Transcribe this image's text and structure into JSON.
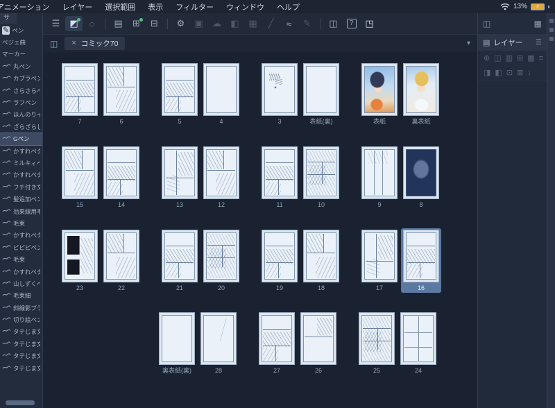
{
  "menubar": {
    "items": [
      "アニメーション",
      "レイヤー",
      "選択範囲",
      "表示",
      "フィルター",
      "ウィンドウ",
      "ヘルプ"
    ],
    "status": {
      "battery": "13%",
      "wifi_icon": "wifi-icon",
      "battery_icon": "battery-charging-icon",
      "bolt": "⚡"
    }
  },
  "toolbar": {
    "tools": [
      {
        "name": "main-menu-icon",
        "glyph": "☰"
      },
      {
        "name": "selection-tool-icon",
        "glyph": "◩",
        "active": true,
        "badge": true
      },
      {
        "name": "deselect-icon",
        "glyph": "◌"
      },
      {
        "sep": true
      },
      {
        "name": "page-manager-icon",
        "glyph": "▤"
      },
      {
        "name": "add-page-icon",
        "glyph": "⊞",
        "badge": true
      },
      {
        "name": "delete-page-icon",
        "glyph": "⊟"
      },
      {
        "sep": true
      },
      {
        "name": "settings-gear-icon",
        "glyph": "⚙"
      },
      {
        "name": "layers-stack-icon",
        "glyph": "▣",
        "disabled": true
      },
      {
        "name": "cloud-sync-icon",
        "glyph": "☁",
        "disabled": true
      },
      {
        "name": "fill-tool-icon",
        "glyph": "◧",
        "disabled": true
      },
      {
        "name": "grid-view-icon",
        "glyph": "▦",
        "disabled": true
      },
      {
        "name": "line-tool-icon",
        "glyph": "╱",
        "disabled": true
      },
      {
        "name": "curve-tool-icon",
        "glyph": "≈"
      },
      {
        "name": "pencil-tool-icon",
        "glyph": "✎",
        "disabled": true
      },
      {
        "sep": true
      },
      {
        "name": "reference-panel-icon",
        "glyph": "◫"
      },
      {
        "name": "help-icon",
        "glyph": "?",
        "boxed": true
      },
      {
        "name": "export-canvas-icon",
        "glyph": "◳",
        "bright": true
      }
    ]
  },
  "tabbar": {
    "title": "コミック70",
    "close": "×",
    "chevron": "▾",
    "pages_view_glyph": "◫"
  },
  "sidebar": {
    "panel_tab": "サ",
    "items": [
      {
        "label": "ペン",
        "pen_icon": true
      },
      {
        "label": "ベジェ曲"
      },
      {
        "label": "マーカー"
      },
      {
        "label": "丸ペン",
        "stroke": true
      },
      {
        "label": "カブラペン",
        "stroke": true
      },
      {
        "label": "さらさらペ",
        "stroke": true
      },
      {
        "label": "ラフペン",
        "stroke": true
      },
      {
        "label": "ほんのりイ",
        "stroke": true
      },
      {
        "label": "ざらざらし",
        "stroke": true
      },
      {
        "label": "Gペン",
        "stroke": true,
        "selected": true
      },
      {
        "label": "かすれペタ",
        "stroke": true
      },
      {
        "label": "ミルキィペ",
        "stroke": true
      },
      {
        "label": "かすれペタ",
        "stroke": true
      },
      {
        "label": "フチ付き文",
        "stroke": true
      },
      {
        "label": "髪追加ペン",
        "stroke": true
      },
      {
        "label": "効果線用毛",
        "stroke": true
      },
      {
        "label": "毛束",
        "stroke": true
      },
      {
        "label": "かすれペタ",
        "stroke": true
      },
      {
        "label": "ピピピペン",
        "stroke": true
      },
      {
        "label": "毛束",
        "stroke": true
      },
      {
        "label": "かすれペタ",
        "stroke": true
      },
      {
        "label": "山しずくペ",
        "stroke": true
      },
      {
        "label": "毛束細",
        "stroke": true
      },
      {
        "label": "斜線影ブラ",
        "stroke": true
      },
      {
        "label": "切り絵ペン",
        "stroke": true
      },
      {
        "label": "タテじま文",
        "stroke": true
      },
      {
        "label": "タテじま文",
        "stroke": true
      },
      {
        "label": "タテじま文",
        "stroke": true
      },
      {
        "label": "タテじま文",
        "stroke": true
      }
    ]
  },
  "pages": {
    "rows": [
      {
        "offset": false,
        "spreads": [
          [
            {
              "label": "7",
              "kind": "v2"
            },
            {
              "label": "6",
              "kind": "v1"
            }
          ],
          [
            {
              "label": "5",
              "kind": "v2"
            },
            {
              "label": "4",
              "kind": "blank"
            }
          ],
          [
            {
              "label": "3",
              "kind": "scribble"
            },
            {
              "label": "表紙(裏)",
              "kind": "blank"
            }
          ],
          [
            {
              "label": "表紙",
              "kind": "coverL"
            },
            {
              "label": "裏表紙",
              "kind": "coverR"
            }
          ]
        ]
      },
      {
        "offset": false,
        "spreads": [
          [
            {
              "label": "15",
              "kind": "v1"
            },
            {
              "label": "14",
              "kind": "v2"
            }
          ],
          [
            {
              "label": "13",
              "kind": "v3"
            },
            {
              "label": "12",
              "kind": "v1"
            }
          ],
          [
            {
              "label": "11",
              "kind": "v2"
            },
            {
              "label": "10",
              "kind": "v4"
            }
          ],
          [
            {
              "label": "9",
              "kind": "lightv"
            },
            {
              "label": "8",
              "kind": "dark"
            }
          ]
        ]
      },
      {
        "offset": false,
        "spreads": [
          [
            {
              "label": "23",
              "kind": "darkpanels"
            },
            {
              "label": "22",
              "kind": "v1"
            }
          ],
          [
            {
              "label": "21",
              "kind": "v2"
            },
            {
              "label": "20",
              "kind": "v4"
            }
          ],
          [
            {
              "label": "19",
              "kind": "v2"
            },
            {
              "label": "18",
              "kind": "v1"
            }
          ],
          [
            {
              "label": "17",
              "kind": "v3"
            },
            {
              "label": "16",
              "kind": "v2",
              "selected": true
            }
          ]
        ]
      },
      {
        "offset": true,
        "spreads": [
          [
            {
              "label": "裏表紙(裏)",
              "kind": "blank"
            },
            {
              "label": "28",
              "kind": "faint"
            }
          ],
          [
            {
              "label": "27",
              "kind": "v2"
            },
            {
              "label": "26",
              "kind": "half"
            }
          ],
          [
            {
              "label": "25",
              "kind": "v4"
            },
            {
              "label": "24",
              "kind": "grid"
            }
          ]
        ]
      }
    ]
  },
  "layer_panel": {
    "title": "レイヤー",
    "header_icon": "▤",
    "header_menu": "☰",
    "topbar_left_glyph": "◫",
    "topbar_right_glyph": "▦",
    "iconrow1": [
      {
        "name": "blend-mode-icon",
        "glyph": "⊕"
      },
      {
        "name": "new-layer-icon",
        "glyph": "◫"
      },
      {
        "name": "new-folder-icon",
        "glyph": "▥"
      },
      {
        "name": "duplicate-layer-icon",
        "glyph": "⊞"
      },
      {
        "name": "merge-layer-icon",
        "glyph": "▦"
      },
      {
        "name": "layer-menu-icon",
        "glyph": "≡"
      }
    ],
    "iconrow2": [
      {
        "name": "lock-layer-icon",
        "glyph": "◨"
      },
      {
        "name": "lock-transparency-icon",
        "glyph": "◧"
      },
      {
        "name": "clipping-icon",
        "glyph": "⊡"
      },
      {
        "name": "mask-icon",
        "glyph": "⊠"
      },
      {
        "name": "delete-layer-icon",
        "glyph": "↓"
      }
    ]
  }
}
